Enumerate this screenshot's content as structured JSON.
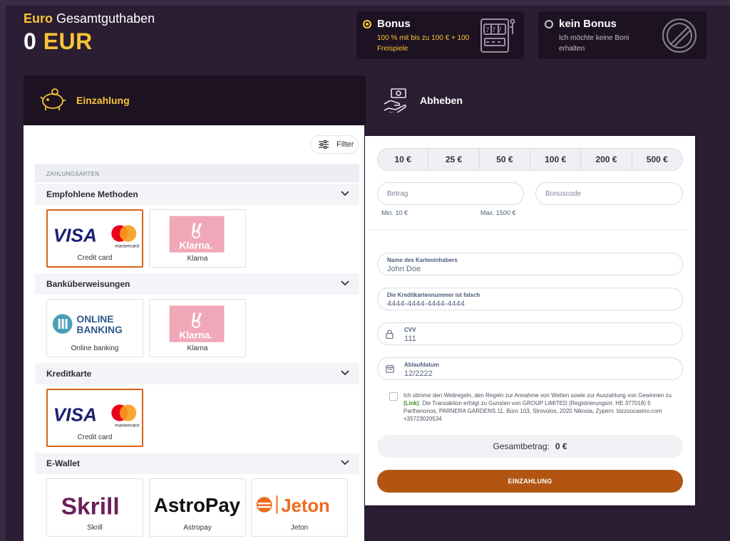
{
  "balance": {
    "label_accent": "Euro",
    "label_rest": "Gesamtguthaben",
    "amount": "0",
    "currency": "EUR"
  },
  "bonus_options": [
    {
      "title": "Bonus",
      "description": "100 % mit bis zu 100 € + 100 Freispiele",
      "selected": true
    },
    {
      "title": "kein Bonus",
      "description": "Ich möchte keine Boni erhalten",
      "selected": false
    }
  ],
  "tabs": [
    {
      "label": "Einzahlung",
      "active": true
    },
    {
      "label": "Abheben",
      "active": false
    }
  ],
  "filter_label": "Filter",
  "payment_section_label": "ZAHLUNGSARTEN",
  "categories": [
    {
      "title": "Empfohlene Methoden",
      "methods": [
        {
          "label": "Credit card",
          "logo": "visa-mastercard",
          "selected": true
        },
        {
          "label": "Klarna",
          "logo": "klarna",
          "selected": false
        }
      ]
    },
    {
      "title": "Banküberweisungen",
      "methods": [
        {
          "label": "Online banking",
          "logo": "online-banking",
          "selected": false
        },
        {
          "label": "Klarna",
          "logo": "klarna",
          "selected": false
        }
      ]
    },
    {
      "title": "Kreditkarte",
      "methods": [
        {
          "label": "Credit card",
          "logo": "visa-mastercard",
          "selected": true
        }
      ]
    },
    {
      "title": "E-Wallet",
      "methods": [
        {
          "label": "Skrill",
          "logo": "skrill",
          "selected": false
        },
        {
          "label": "Astropay",
          "logo": "astropay",
          "selected": false
        },
        {
          "label": "Jeton",
          "logo": "jeton",
          "selected": false
        }
      ]
    }
  ],
  "logo_text": {
    "visa": "VISA",
    "mastercard": "mastercard",
    "klarna": "Klarna.",
    "online_banking_1": "ONLINE",
    "online_banking_2": "BANKING",
    "skrill": "Skrill",
    "astropay": "AstroPay",
    "jeton": "Jeton"
  },
  "amount_presets": [
    "10 €",
    "25 €",
    "50 €",
    "100 €",
    "200 €",
    "500 €"
  ],
  "amount_field": {
    "placeholder": "Betrag",
    "min_hint": "Min. 10 €",
    "max_hint": "Max. 1500 €"
  },
  "bonuscode_field": {
    "placeholder": "Bonuscode"
  },
  "card_form": {
    "holder": {
      "label": "Name des Karteninhabers",
      "value": "John Doe"
    },
    "number": {
      "label": "Die Kreditkartennummer ist falsch",
      "value": "4444-4444-4444-4444"
    },
    "cvv": {
      "label": "CVV",
      "value": "111"
    },
    "expiry": {
      "label": "Ablaufdatum",
      "value": "12/2222"
    }
  },
  "terms": {
    "text_before": "Ich stimme den Wettregeln, den Regeln zur Annahme von Wetten sowie zur Auszahlung von Gewinnen zu ",
    "link": "(Link)",
    "text_after": ". Die Transaktion erfolgt zu Gunsten von GROUP LIMITED (Registrierungsnr. HE 377018) 5 Parthenonos, PARNERA GARDENS 11, Büro 103, Strovolos, 2020 Nikosia, Zypern. bizzoocasino.com +35723020534"
  },
  "total": {
    "label": "Gesamtbetrag:",
    "value": "0 €"
  },
  "submit_label": "EINZAHLUNG",
  "colors": {
    "accent_yellow": "#f8c534",
    "header_bg": "#2b1d33",
    "card_bg": "#1d1222",
    "submit": "#b25512",
    "selected_border": "#d6641a"
  }
}
